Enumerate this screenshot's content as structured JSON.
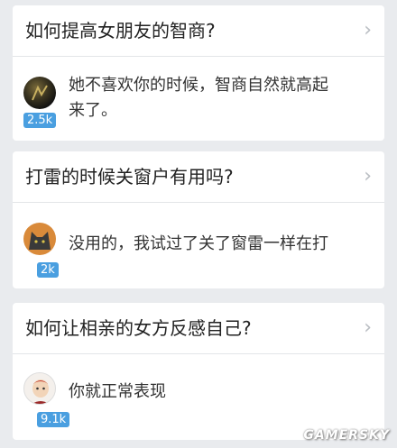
{
  "cards": [
    {
      "question": "如何提高女朋友的智商?",
      "answer": "她不喜欢你的时候，智商自然就高起来了。",
      "answer_line1": "她不喜欢你的时候，智商自然就高起",
      "answer_line2": "来了。",
      "votes": "2.5k",
      "avatar": "dark-photo-avatar"
    },
    {
      "question": "打雷的时候关窗户有用吗?",
      "answer": "没用的，我试过了关了窗雷一样在打",
      "votes": "2k",
      "avatar": "cat-avatar"
    },
    {
      "question": "如何让相亲的女方反感自己?",
      "answer": "你就正常表现",
      "votes": "9.1k",
      "avatar": "cartoon-person-avatar"
    }
  ],
  "icons": {
    "chevron": "chevron-right-icon"
  },
  "colors": {
    "badge": "#4a9fe0",
    "background": "#e9ebee"
  },
  "watermark": "GAMERSKY"
}
